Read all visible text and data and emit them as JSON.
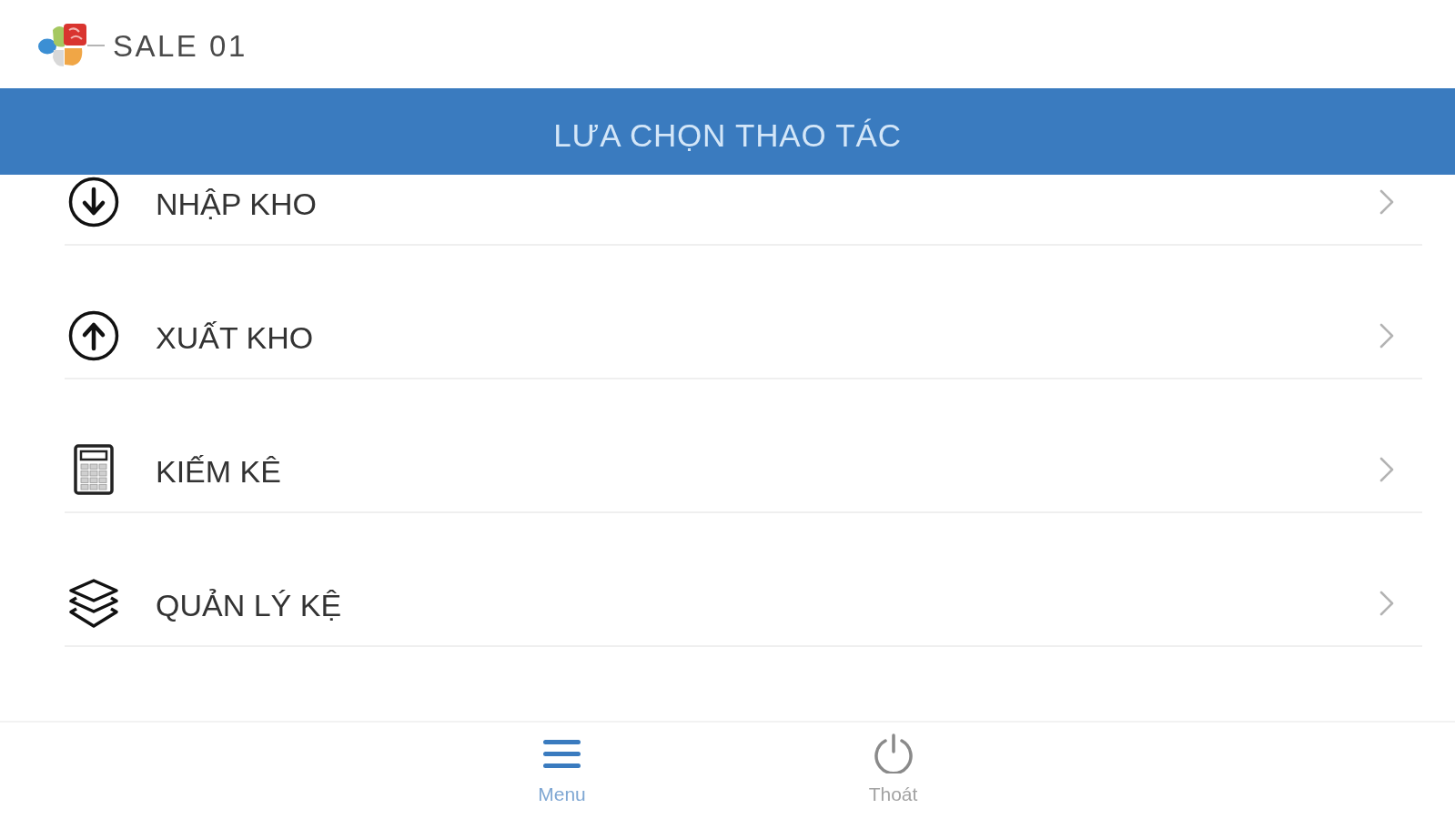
{
  "header": {
    "title": "SALE 01"
  },
  "section_bar": {
    "title": "LƯA CHỌN THAO TÁC"
  },
  "menu_items": [
    {
      "label": "NHẬP KHO"
    },
    {
      "label": "XUẤT KHO"
    },
    {
      "label": "KIẾM KÊ"
    },
    {
      "label": "QUẢN LÝ KỆ"
    }
  ],
  "tab_bar": {
    "tabs": [
      {
        "label": "Menu",
        "selected": true
      },
      {
        "label": "Thoát",
        "selected": false
      }
    ]
  }
}
